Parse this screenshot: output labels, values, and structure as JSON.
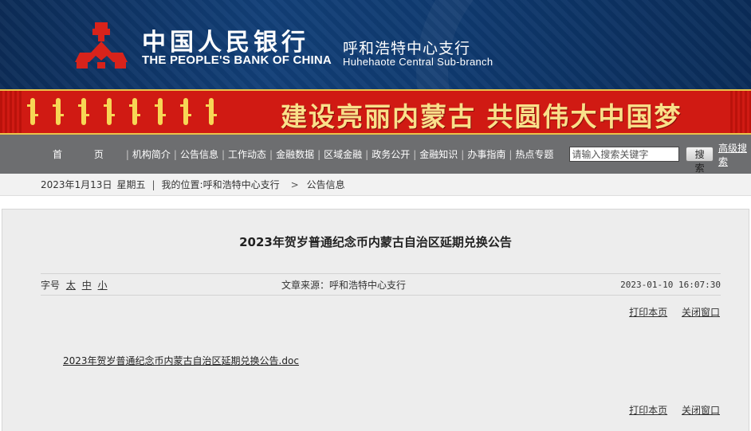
{
  "header": {
    "bank_name_cn": "中国人民银行",
    "bank_name_en": "THE PEOPLE'S BANK OF CHINA",
    "branch_cn": "呼和浩特中心支行",
    "branch_en": "Huhehaote  Central  Sub-branch",
    "logo_color": "#d8231b"
  },
  "banner": {
    "slogan": "建设亮丽内蒙古  共圆伟大中国梦",
    "background_color": "#d01a13",
    "text_color": "#f9e08a"
  },
  "nav": {
    "items": [
      "首 页",
      "机构简介",
      "公告信息",
      "工作动态",
      "金融数据",
      "区域金融",
      "政务公开",
      "金融知识",
      "办事指南",
      "热点专题"
    ],
    "search_placeholder": "请输入搜索关键字",
    "search_button": "搜索",
    "advanced_search": "高级搜索"
  },
  "breadcrumb": {
    "date": "2023年1月13日",
    "weekday": "星期五",
    "location_label": "我的位置:",
    "location_root": "呼和浩特中心支行",
    "arrow": ">",
    "current": "公告信息"
  },
  "article": {
    "title": "2023年贺岁普通纪念币内蒙古自治区延期兑换公告",
    "font_size_label": "字号",
    "font_sizes": [
      "太",
      "中",
      "小"
    ],
    "source": "文章来源：呼和浩特中心支行",
    "datetime": "2023-01-10 16:07:30",
    "print_label": "打印本页",
    "close_label": "关闭窗口",
    "attachment": "2023年贺岁普通纪念币内蒙古自治区延期兑换公告.doc"
  }
}
